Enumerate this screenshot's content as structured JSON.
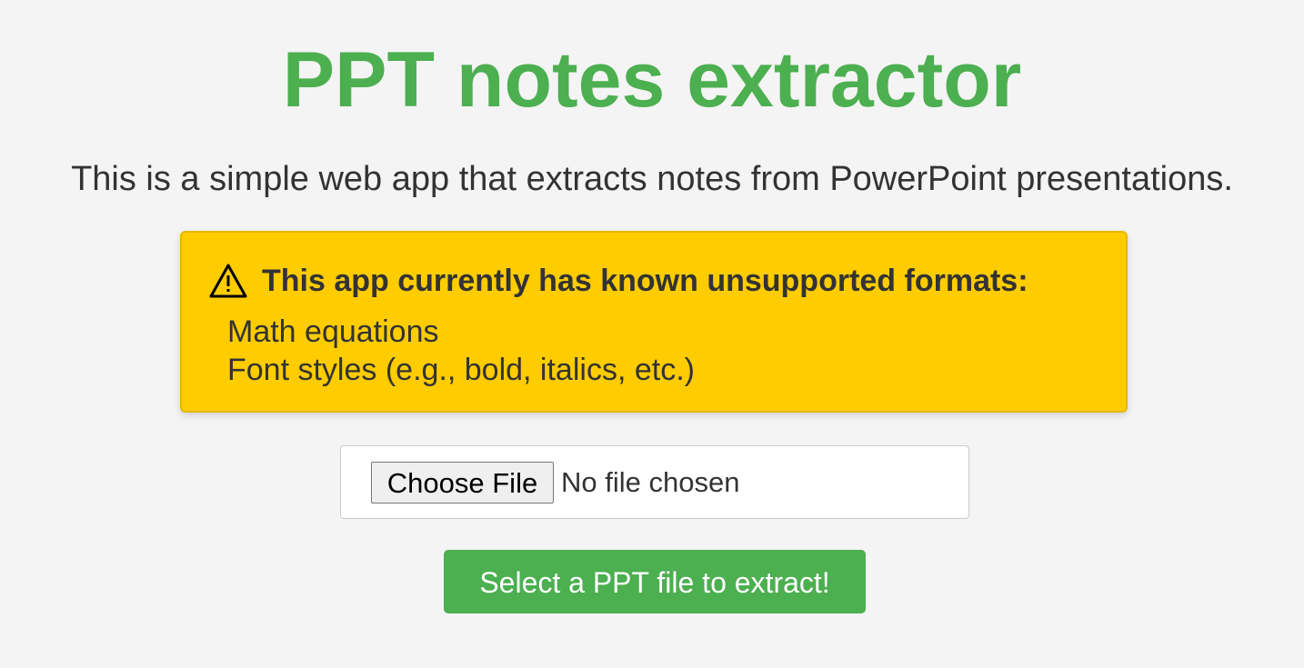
{
  "header": {
    "title": "PPT notes extractor",
    "subtitle": "This is a simple web app that extracts notes from PowerPoint presentations."
  },
  "warning": {
    "icon": "warning-triangle-icon",
    "title": "This app currently has known unsupported formats:",
    "items": [
      "Math equations",
      "Font styles (e.g., bold, italics, etc.)"
    ]
  },
  "file_input": {
    "button_label": "Choose File",
    "status": "No file chosen"
  },
  "submit": {
    "label": "Select a PPT file to extract!"
  },
  "colors": {
    "accent": "#4caf50",
    "warning_bg": "#ffcc00",
    "page_bg": "#f4f4f4",
    "text": "#333333"
  }
}
